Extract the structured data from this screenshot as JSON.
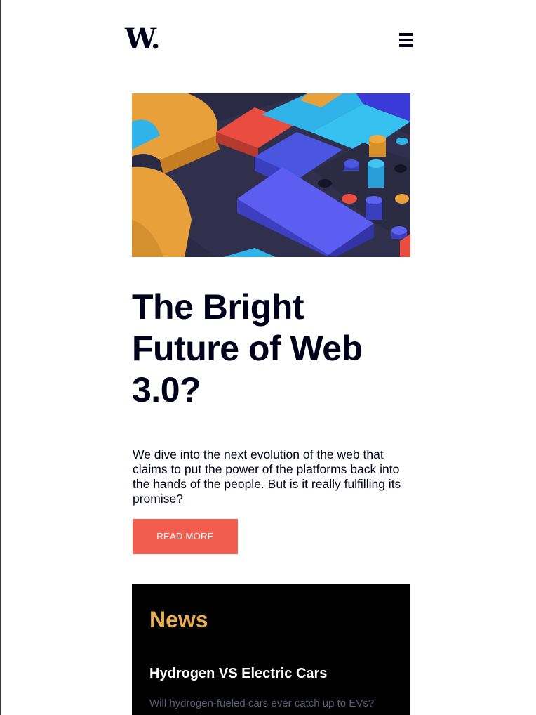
{
  "header": {
    "logo_text": "W.",
    "menu_icon": "hamburger-menu-icon"
  },
  "hero": {
    "image_description_icon": "abstract-3d-blocks-image",
    "title": "The Bright Future of Web 3.0?",
    "description": "We dive into the next evolution of the web that claims to put the power of the platforms back into the hands of the people. But is it really fulfilling its promise?",
    "button_label": "READ MORE",
    "accent_color": "#f15e50"
  },
  "news": {
    "heading": "News",
    "heading_color": "#e9ab53",
    "items": [
      {
        "title": "Hydrogen VS Electric Cars",
        "description": "Will hydrogen-fueled cars ever catch up to EVs?"
      }
    ]
  }
}
